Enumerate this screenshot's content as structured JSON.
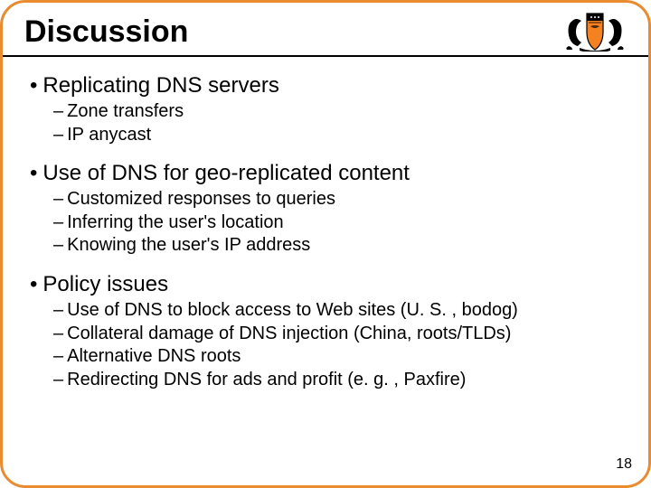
{
  "title": "Discussion",
  "page_number": "18",
  "sections": [
    {
      "heading": "Replicating DNS servers",
      "items": [
        "Zone transfers",
        "IP anycast"
      ]
    },
    {
      "heading": "Use of DNS for geo-replicated content",
      "items": [
        "Customized responses to queries",
        "Inferring the user's location",
        "Knowing the user's IP address"
      ]
    },
    {
      "heading": "Policy issues",
      "items": [
        "Use of DNS to block access to Web sites (U. S. , bodog)",
        "Collateral damage of DNS injection (China, roots/TLDs)",
        "Alternative DNS roots",
        "Redirecting DNS for ads and profit (e. g. , Paxfire)"
      ]
    }
  ]
}
